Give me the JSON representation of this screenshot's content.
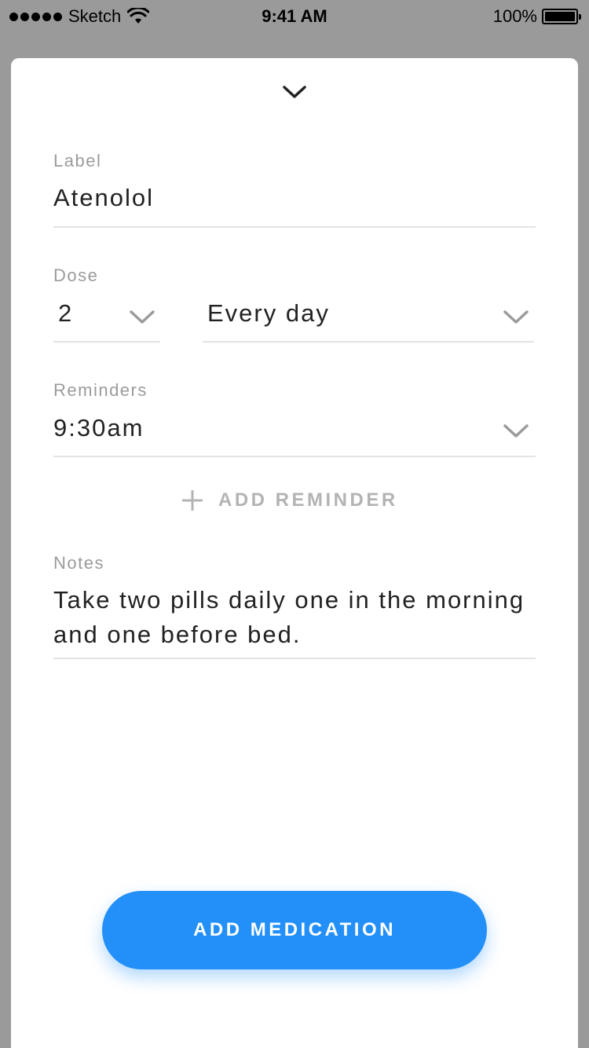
{
  "status_bar": {
    "carrier": "Sketch",
    "time": "9:41 AM",
    "battery": "100%"
  },
  "form": {
    "label": {
      "title": "Label",
      "value": "Atenolol"
    },
    "dose": {
      "title": "Dose",
      "quantity": "2",
      "frequency": "Every day"
    },
    "reminders": {
      "title": "Reminders",
      "time": "9:30am"
    },
    "add_reminder": "ADD REMINDER",
    "notes": {
      "title": "Notes",
      "value": "Take two pills daily one in the morning and one before bed."
    }
  },
  "actions": {
    "primary": "ADD MEDICATION"
  },
  "colors": {
    "accent": "#2290f8",
    "backdrop": "#9a9a9a"
  },
  "icons": [
    "signal-dots-icon",
    "wifi-icon",
    "battery-icon",
    "chevron-down-icon",
    "plus-icon"
  ]
}
